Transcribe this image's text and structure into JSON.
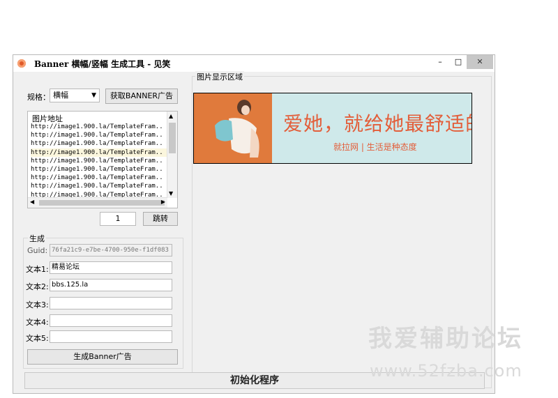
{
  "window": {
    "title": "Banner 横幅/竖幅 生成工具 - 见笑",
    "min_glyph": "–",
    "max_glyph": "□",
    "close_glyph": "✕"
  },
  "spec": {
    "label": "规格：",
    "selected": "横幅",
    "get_button": "获取BANNER广告"
  },
  "url_list": {
    "header": "图片地址",
    "items": [
      "http://image1.900.la/TemplateFram..",
      "http://image1.900.la/TemplateFram..",
      "http://image1.900.la/TemplateFram..",
      "http://image1.900.la/TemplateFram..",
      "http://image1.900.la/TemplateFram..",
      "http://image1.900.la/TemplateFram..",
      "http://image1.900.la/TemplateFram..",
      "http://image1.900.la/TemplateFram..",
      "http://image1.900.la/TemplateFram.."
    ],
    "selected_index": 3
  },
  "pager": {
    "value": "1",
    "jump_button": "跳转"
  },
  "generate": {
    "group_label": "生成",
    "guid_label": "Guid:",
    "guid_value": "76fa21c9-e7be-4700-950e-f1df083",
    "text1_label": "文本1:",
    "text1_value": "精易论坛",
    "text2_label": "文本2:",
    "text2_value": "bbs.125.la",
    "text3_label": "文本3:",
    "text3_value": "",
    "text4_label": "文本4:",
    "text4_value": "",
    "text5_label": "文本5:",
    "text5_value": "",
    "generate_button": "生成Banner广告"
  },
  "display": {
    "label": "图片显示区域",
    "slogan": "爱她，就给她最舒适的一切",
    "tagline": "就拉网 | 生活是种态度"
  },
  "status": {
    "text": "初始化程序"
  },
  "watermark": {
    "cn": "我爱辅助论坛",
    "url": "www.52fzba.com"
  },
  "colors": {
    "accent": "#e35e3a",
    "banner_bg": "#cfe9ea",
    "selected_row": "#fbf6dd"
  }
}
